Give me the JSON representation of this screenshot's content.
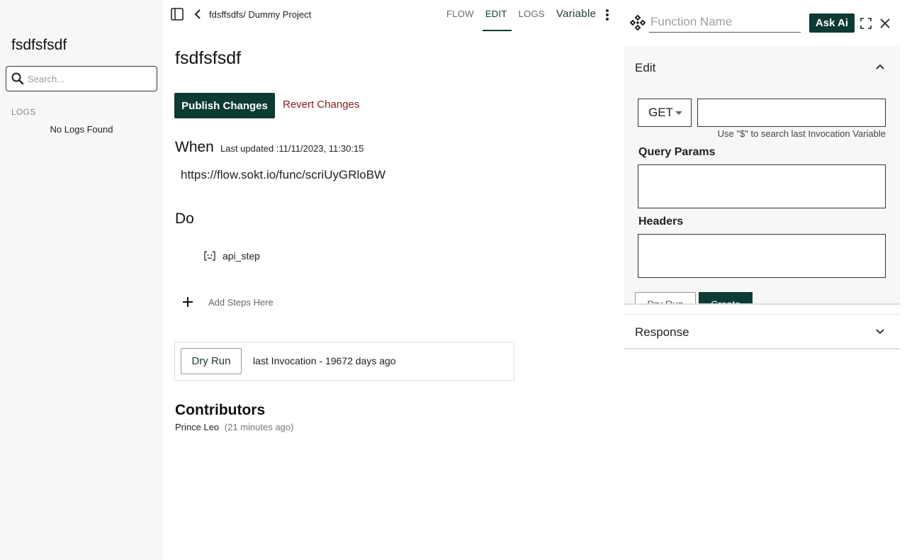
{
  "sidebar": {
    "title": "fsdfsfsdf",
    "search_placeholder": "Search...",
    "logs_heading": "LOGS",
    "empty_message": "No Logs Found"
  },
  "topbar": {
    "breadcrumb": "fdsffsdfs/ Dummy Project",
    "tabs": [
      {
        "label": "FLOW",
        "active": false
      },
      {
        "label": "EDIT",
        "active": true
      },
      {
        "label": "LOGS",
        "active": false
      },
      {
        "label": "Variable",
        "active": false
      }
    ]
  },
  "main": {
    "title": "fsdfsfsdf",
    "publish_label": "Publish Changes",
    "revert_label": "Revert Changes",
    "when_heading": "When",
    "last_updated": "Last updated :11/11/2023, 11:30:15",
    "url": "https://flow.sokt.io/func/scriUyGRloBW",
    "do_heading": "Do",
    "step_name": "api_step",
    "add_steps_label": "Add Steps Here",
    "dry_run_label": "Dry Run",
    "last_invocation": "last Invocation - 19672 days ago",
    "contributors_heading": "Contributors",
    "contributor_name": "Prince Leo",
    "contributor_time": "(21 minutes ago)"
  },
  "right_panel": {
    "function_name_placeholder": "Function Name",
    "ask_ai_label": "Ask Ai",
    "edit_heading": "Edit",
    "method": "GET",
    "url_value": "",
    "url_hint": "Use \"$\" to search last Invocation Variable",
    "query_params_label": "Query Params",
    "headers_label": "Headers",
    "dry_run_label": "Dry Run",
    "create_label": "Create",
    "response_heading": "Response"
  },
  "colors": {
    "primary": "#0b3b33",
    "revert": "#8b1a1a"
  }
}
